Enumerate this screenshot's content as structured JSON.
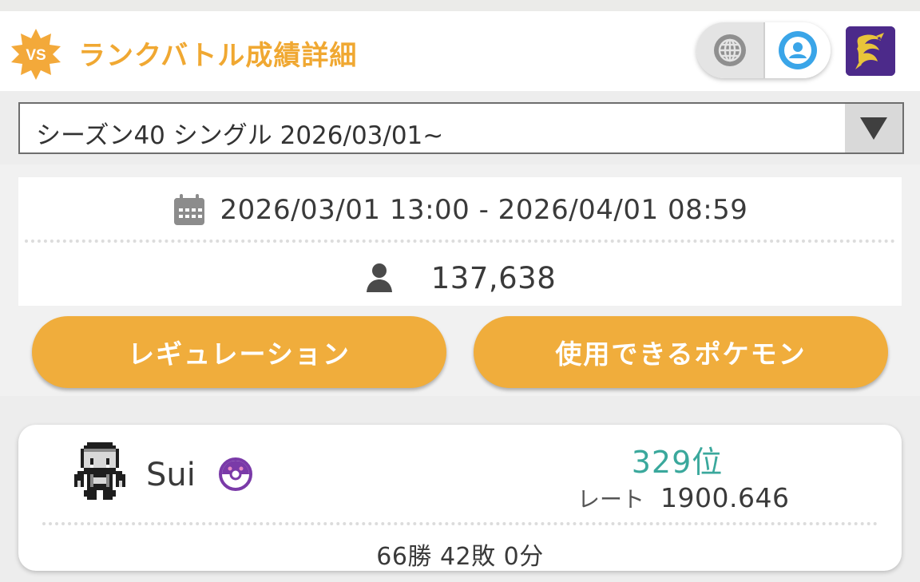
{
  "header": {
    "vs_badge_text": "VS",
    "title": "ランクバトル成績詳細",
    "icons": [
      "globe-icon",
      "profile-icon",
      "app-icon"
    ],
    "colors": {
      "title": "#f0a832",
      "badge": "#f3a93a",
      "profile": "#3aa5e8",
      "app_icon_bg": "#4c2a8a"
    }
  },
  "season_select": {
    "value": "シーズン40 シングル 2026/03/01~",
    "arrow_icon": "triangle-down-icon"
  },
  "season_info": {
    "period": "2026/03/01 13:00 - 2026/04/01 08:59",
    "players": "137,638",
    "icons": [
      "calendar-icon",
      "person-icon"
    ]
  },
  "buttons": {
    "regulation": "レギュレーション",
    "usable_pokemon": "使用できるポケモン",
    "color": "#f0ad3c"
  },
  "player": {
    "name": "Sui",
    "rank": "329位",
    "rate_label": "レート",
    "rate_value": "1900.646",
    "record": "66勝 42敗 0分",
    "icons": [
      "trainer-avatar-icon",
      "master-ball-icon"
    ],
    "rank_color": "#3aa89c"
  }
}
